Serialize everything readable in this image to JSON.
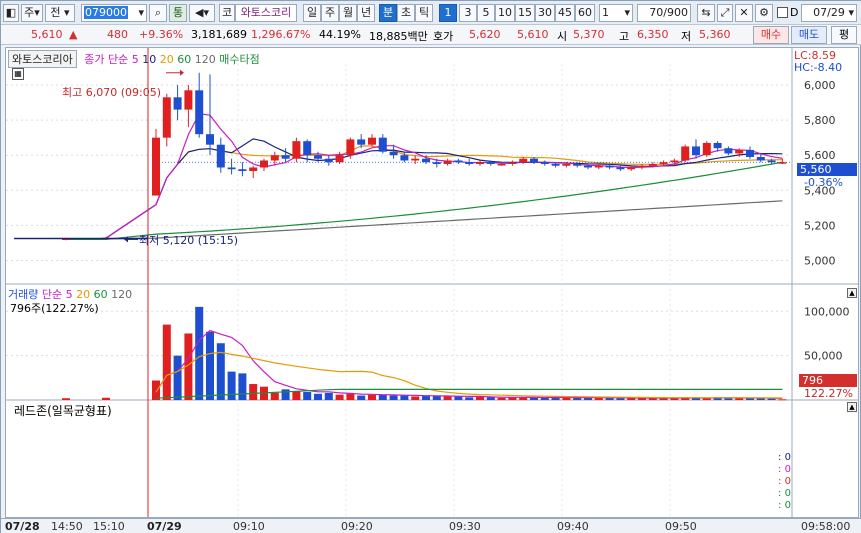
{
  "toolbar": {
    "market": "주",
    "type": "전",
    "code_prefix": "079",
    "code_suffix": "000",
    "mode": "통",
    "kospi_tag": "코",
    "stock_name": "와토스코리",
    "periods": [
      "일",
      "주",
      "월",
      "년",
      "분",
      "초",
      "틱"
    ],
    "active_period": "분",
    "minutes": [
      "1",
      "3",
      "5",
      "10",
      "15",
      "30",
      "45",
      "60"
    ],
    "active_minute": "1",
    "interval_value": "1",
    "count": "70/900",
    "date": "07/29",
    "date_checkbox_label": "D"
  },
  "quote": {
    "price": "5,610",
    "arrow": "▲",
    "change": "480",
    "change_pct": "+9.36%",
    "volume": "3,181,689",
    "volume_ratio": "1,296.67%",
    "turnover": "44.19%",
    "amount": "18,885백만",
    "ask_label": "호가",
    "ask_price": "5,620",
    "bid_price": "5,610",
    "open_label": "시",
    "open": "5,370",
    "high_label": "고",
    "high": "6,350",
    "low_label": "저",
    "low": "5,360",
    "buy_btn": "매수",
    "sell_btn": "매도",
    "avg_btn": "평"
  },
  "price_panel": {
    "stock_label": "와토스코리아",
    "ma_label": "종가 단순",
    "ma_periods": [
      "5",
      "10",
      "20",
      "60",
      "120"
    ],
    "signal_label": "매수타점",
    "lc_label": "LC:8.59",
    "hc_label": "HC:-8.40",
    "current_price": "5,560",
    "current_pct": "-0.36%",
    "high_annotation": "최고 6,070 (09:05)",
    "low_annotation": "최저 5,120 (15:15)",
    "y_ticks": [
      "6,000",
      "5,800",
      "5,600",
      "5,400",
      "5,200",
      "5,000"
    ]
  },
  "volume_panel": {
    "title": "거래량",
    "ma_label": "단순",
    "ma_periods": [
      "5",
      "20",
      "60",
      "120"
    ],
    "current": "796주(122.27%)",
    "y_ticks": [
      "100,000",
      "50,000"
    ],
    "last_value": "796",
    "last_pct": "122.27%"
  },
  "indicator_panel": {
    "title": "레드존(일목균형표)",
    "values": [
      "0",
      "0",
      "0",
      "0",
      "0"
    ]
  },
  "xaxis": {
    "labels": [
      "07/28",
      "14:50",
      "15:10",
      "07/29",
      "09:10",
      "09:20",
      "09:30",
      "09:40",
      "09:50",
      "09:58:00"
    ]
  },
  "colors": {
    "up": "#e02020",
    "down": "#1f4fd1",
    "ma5": "#c81cc8",
    "ma10": "#1a237e",
    "ma20": "#e39b00",
    "ma60": "#1b8e3a",
    "ma120": "#6b6b6b"
  },
  "chart_data": {
    "type": "candlestick",
    "times": [
      "14:50",
      "15:10",
      "09:00",
      "09:01",
      "09:02",
      "09:03",
      "09:04",
      "09:05",
      "09:06",
      "09:07",
      "09:08",
      "09:09",
      "09:10",
      "09:11",
      "09:12",
      "09:13",
      "09:14",
      "09:15",
      "09:16",
      "09:17",
      "09:18",
      "09:19",
      "09:20",
      "09:21",
      "09:22",
      "09:23",
      "09:24",
      "09:25",
      "09:26",
      "09:27",
      "09:28",
      "09:29",
      "09:30",
      "09:31",
      "09:32",
      "09:33",
      "09:34",
      "09:35",
      "09:36",
      "09:37",
      "09:38",
      "09:39",
      "09:40",
      "09:41",
      "09:42",
      "09:43",
      "09:44",
      "09:45",
      "09:46",
      "09:47",
      "09:48",
      "09:49",
      "09:50",
      "09:51",
      "09:52",
      "09:53",
      "09:54",
      "09:55",
      "09:56",
      "09:57",
      "09:58"
    ],
    "ohlc": [
      [
        5120,
        5130,
        5115,
        5125
      ],
      [
        5125,
        5135,
        5120,
        5130
      ],
      [
        5370,
        5750,
        5370,
        5700
      ],
      [
        5700,
        5950,
        5650,
        5930
      ],
      [
        5930,
        6000,
        5800,
        5860
      ],
      [
        5860,
        6000,
        5760,
        5970
      ],
      [
        5970,
        6070,
        5700,
        5720
      ],
      [
        5720,
        6060,
        5600,
        5660
      ],
      [
        5660,
        5700,
        5500,
        5530
      ],
      [
        5530,
        5580,
        5490,
        5520
      ],
      [
        5520,
        5560,
        5480,
        5510
      ],
      [
        5510,
        5540,
        5470,
        5530
      ],
      [
        5530,
        5580,
        5510,
        5570
      ],
      [
        5570,
        5620,
        5540,
        5600
      ],
      [
        5600,
        5640,
        5560,
        5580
      ],
      [
        5580,
        5700,
        5560,
        5680
      ],
      [
        5680,
        5690,
        5560,
        5600
      ],
      [
        5600,
        5620,
        5560,
        5580
      ],
      [
        5580,
        5600,
        5540,
        5560
      ],
      [
        5560,
        5620,
        5550,
        5600
      ],
      [
        5600,
        5700,
        5580,
        5690
      ],
      [
        5690,
        5720,
        5640,
        5660
      ],
      [
        5660,
        5720,
        5650,
        5700
      ],
      [
        5700,
        5720,
        5610,
        5620
      ],
      [
        5620,
        5660,
        5580,
        5600
      ],
      [
        5600,
        5620,
        5560,
        5570
      ],
      [
        5570,
        5600,
        5550,
        5580
      ],
      [
        5580,
        5600,
        5550,
        5560
      ],
      [
        5560,
        5580,
        5530,
        5550
      ],
      [
        5550,
        5580,
        5540,
        5570
      ],
      [
        5570,
        5580,
        5550,
        5560
      ],
      [
        5560,
        5580,
        5540,
        5550
      ],
      [
        5550,
        5570,
        5540,
        5560
      ],
      [
        5560,
        5570,
        5540,
        5550
      ],
      [
        5550,
        5560,
        5540,
        5550
      ],
      [
        5550,
        5570,
        5540,
        5560
      ],
      [
        5560,
        5590,
        5550,
        5580
      ],
      [
        5580,
        5590,
        5550,
        5560
      ],
      [
        5560,
        5570,
        5540,
        5550
      ],
      [
        5550,
        5560,
        5530,
        5540
      ],
      [
        5540,
        5560,
        5530,
        5550
      ],
      [
        5550,
        5560,
        5530,
        5540
      ],
      [
        5540,
        5550,
        5520,
        5530
      ],
      [
        5530,
        5550,
        5520,
        5540
      ],
      [
        5540,
        5550,
        5520,
        5530
      ],
      [
        5530,
        5540,
        5510,
        5520
      ],
      [
        5520,
        5540,
        5510,
        5530
      ],
      [
        5530,
        5550,
        5520,
        5540
      ],
      [
        5540,
        5560,
        5530,
        5550
      ],
      [
        5550,
        5570,
        5540,
        5560
      ],
      [
        5560,
        5580,
        5540,
        5570
      ],
      [
        5570,
        5660,
        5560,
        5650
      ],
      [
        5650,
        5690,
        5580,
        5600
      ],
      [
        5600,
        5680,
        5590,
        5670
      ],
      [
        5670,
        5680,
        5620,
        5640
      ],
      [
        5640,
        5650,
        5600,
        5610
      ],
      [
        5610,
        5640,
        5590,
        5630
      ],
      [
        5630,
        5650,
        5580,
        5590
      ],
      [
        5590,
        5610,
        5560,
        5570
      ],
      [
        5570,
        5580,
        5550,
        5560
      ],
      [
        5560,
        5580,
        5550,
        5560
      ]
    ],
    "ylim_price": [
      4900,
      6120
    ],
    "ylim_volume": [
      0,
      115000
    ],
    "volume": [
      2000,
      2500,
      22000,
      85000,
      50000,
      75000,
      105000,
      77000,
      64000,
      32000,
      30000,
      18000,
      15000,
      8000,
      12000,
      10000,
      9000,
      7000,
      8000,
      6000,
      7000,
      5000,
      6000,
      6000,
      5000,
      5000,
      4000,
      4500,
      5000,
      4000,
      4000,
      3000,
      3500,
      3000,
      2500,
      3000,
      3000,
      3000,
      2500,
      2500,
      3000,
      2500,
      3000,
      2500,
      2500,
      2000,
      2500,
      2000,
      2500,
      2000,
      2000,
      3000,
      2500,
      2000,
      3000,
      2000,
      2500,
      2000,
      2000,
      1500,
      796
    ]
  }
}
